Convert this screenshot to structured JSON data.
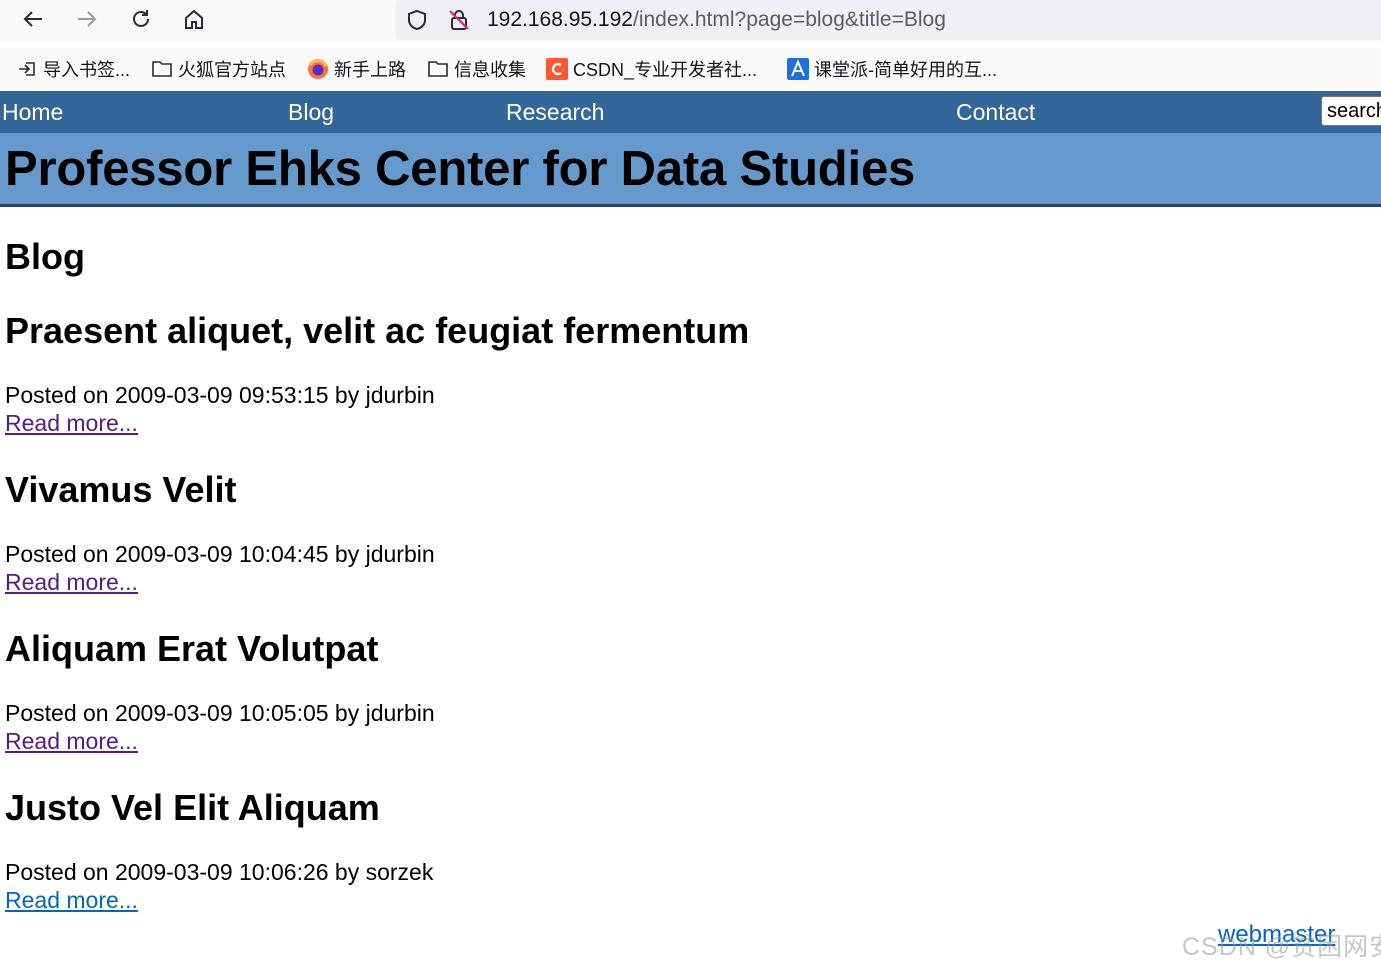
{
  "browser": {
    "url_host": "192.168.95.192",
    "url_path": "/index.html?page=blog&title=Blog",
    "bookmarks": [
      {
        "label": "导入书签...",
        "icon": "import-icon"
      },
      {
        "label": "火狐官方站点",
        "icon": "folder-icon"
      },
      {
        "label": "新手上路",
        "icon": "firefox-icon"
      },
      {
        "label": "信息收集",
        "icon": "folder-icon"
      },
      {
        "label": "CSDN_专业开发者社...",
        "icon": "csdn-icon"
      },
      {
        "label": "课堂派-简单好用的互...",
        "icon": "ketangpai-icon"
      }
    ]
  },
  "nav": {
    "items": [
      "Home",
      "Blog",
      "Research",
      "Contact"
    ],
    "search_value": "search"
  },
  "site": {
    "title": "Professor Ehks Center for Data Studies"
  },
  "page": {
    "heading": "Blog",
    "posts": [
      {
        "title": "Praesent aliquet, velit ac feugiat fermentum",
        "meta": "Posted on 2009-03-09 09:53:15 by jdurbin",
        "link": "Read more..."
      },
      {
        "title": "Vivamus Velit",
        "meta": "Posted on 2009-03-09 10:04:45 by jdurbin",
        "link": "Read more..."
      },
      {
        "title": "Aliquam Erat Volutpat",
        "meta": "Posted on 2009-03-09 10:05:05 by jdurbin",
        "link": "Read more..."
      },
      {
        "title": "Justo Vel Elit Aliquam",
        "meta": "Posted on 2009-03-09 10:06:26 by sorzek",
        "link": "Read more..."
      }
    ]
  },
  "footer": {
    "link": "webmaster",
    "watermark": "CSDN @贫困网安"
  },
  "colors": {
    "nav_bg": "#336699",
    "banner_bg": "#6699cc",
    "link_visited": "#551a8b",
    "link": "#0066cc"
  }
}
